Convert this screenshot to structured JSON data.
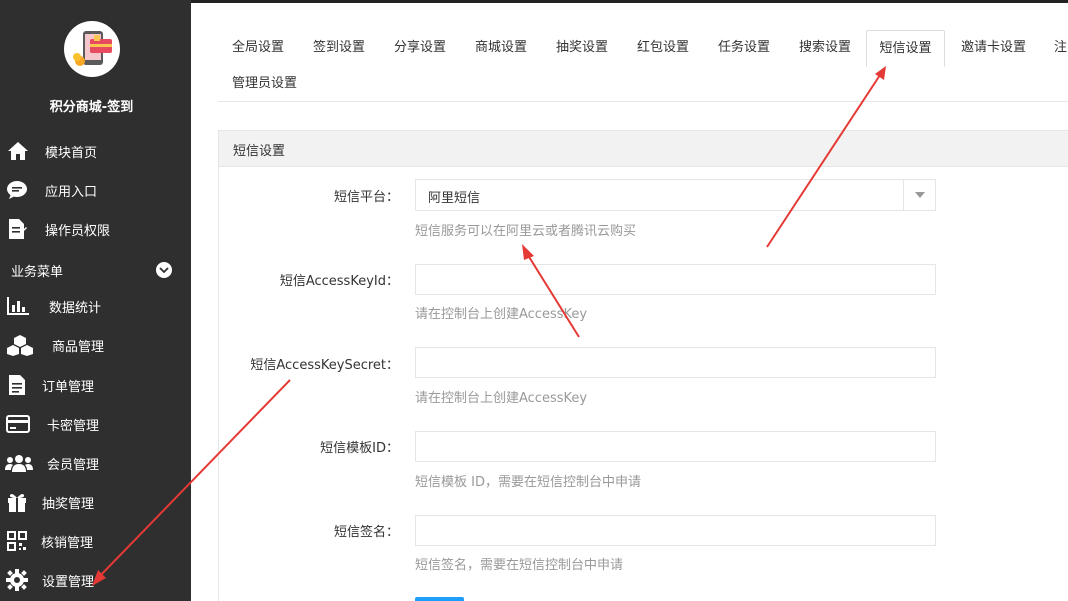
{
  "app": {
    "name": "积分商城-签到"
  },
  "sidebar": {
    "items": [
      {
        "label": "模块首页",
        "icon": "home-icon"
      },
      {
        "label": "应用入口",
        "icon": "chat-icon"
      },
      {
        "label": "操作员权限",
        "icon": "document-edit-icon"
      }
    ],
    "section_label": "业务菜单",
    "business_items": [
      {
        "label": "数据统计",
        "icon": "bar-chart-icon"
      },
      {
        "label": "商品管理",
        "icon": "cubes-icon"
      },
      {
        "label": "订单管理",
        "icon": "file-text-icon"
      },
      {
        "label": "卡密管理",
        "icon": "credit-card-icon"
      },
      {
        "label": "会员管理",
        "icon": "users-icon"
      },
      {
        "label": "抽奖管理",
        "icon": "gift-icon"
      },
      {
        "label": "核销管理",
        "icon": "qrcode-icon"
      },
      {
        "label": "设置管理",
        "icon": "gear-icon"
      }
    ]
  },
  "tabs": [
    "全局设置",
    "签到设置",
    "分享设置",
    "商城设置",
    "抽奖设置",
    "红包设置",
    "任务设置",
    "搜索设置",
    "短信设置",
    "邀请卡设置",
    "注",
    "管理员设置"
  ],
  "panel": {
    "title": "短信设置",
    "platform": {
      "label": "短信平台：",
      "value": "阿里短信",
      "help": "短信服务可以在阿里云或者腾讯云购买"
    },
    "access_key_id": {
      "label": "短信AccessKeyId：",
      "value": "",
      "help": "请在控制台上创建AccessKey"
    },
    "access_key_secret": {
      "label": "短信AccessKeySecret：",
      "value": "",
      "help": "请在控制台上创建AccessKey"
    },
    "template_id": {
      "label": "短信模板ID：",
      "value": "",
      "help": "短信模板 ID，需要在短信控制台中申请"
    },
    "signature": {
      "label": "短信签名：",
      "value": "",
      "help": "短信签名，需要在短信控制台中申请"
    }
  },
  "colors": {
    "sidebar_bg": "#2f2f2f",
    "annotation_arrow": "#e53935",
    "button_blue": "#1e9fff"
  }
}
